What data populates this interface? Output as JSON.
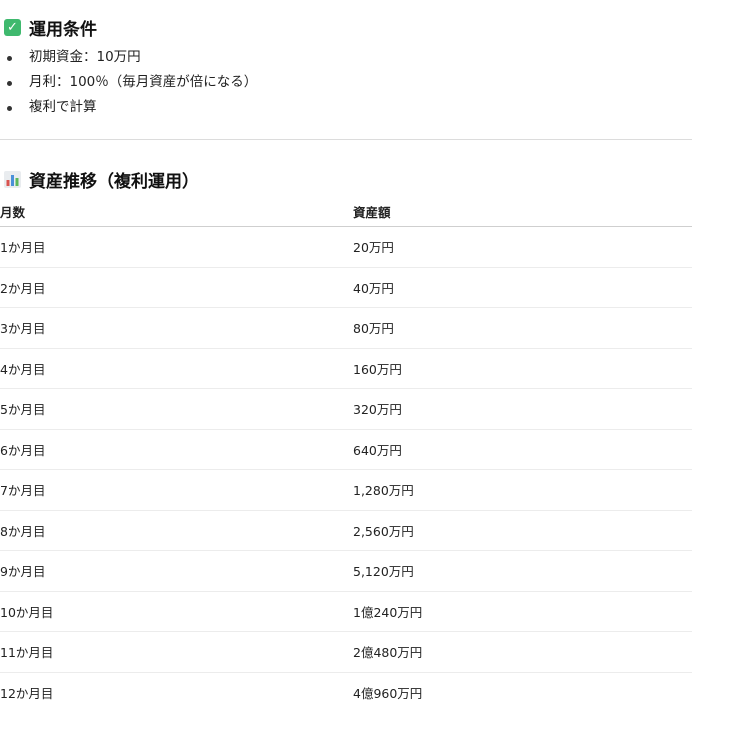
{
  "conditions": {
    "heading": "運用条件",
    "heading_icon": "check-icon",
    "items": [
      "初期資金：10万円",
      "月利：100％（毎月資産が倍になる）",
      "複利で計算"
    ]
  },
  "growth": {
    "heading": "資産推移（複利運用）",
    "heading_icon": "bar-chart-icon",
    "columns": [
      "月数",
      "資産額"
    ],
    "rows": [
      {
        "month": "1か月目",
        "amount": "20万円"
      },
      {
        "month": "2か月目",
        "amount": "40万円"
      },
      {
        "month": "3か月目",
        "amount": "80万円"
      },
      {
        "month": "4か月目",
        "amount": "160万円"
      },
      {
        "month": "5か月目",
        "amount": "320万円"
      },
      {
        "month": "6か月目",
        "amount": "640万円"
      },
      {
        "month": "7か月目",
        "amount": "1,280万円"
      },
      {
        "month": "8か月目",
        "amount": "2,560万円"
      },
      {
        "month": "9か月目",
        "amount": "5,120万円"
      },
      {
        "month": "10か月目",
        "amount": "1億240万円"
      },
      {
        "month": "11か月目",
        "amount": "2億480万円"
      },
      {
        "month": "12か月目",
        "amount": "4億960万円"
      }
    ]
  },
  "colors": {
    "check_icon_bg": "#3fb96e",
    "divider": "#dcdcdc"
  }
}
